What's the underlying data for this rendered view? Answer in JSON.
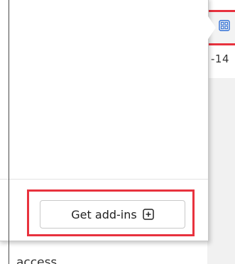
{
  "popup": {
    "get_addins_button": {
      "label": "Get add-ins",
      "icon": "plus-square-icon"
    }
  },
  "background": {
    "cut_number": "-14",
    "cut_text": "access",
    "addins_icon": "addins-grid-icon"
  },
  "colors": {
    "highlight": "#e8323e",
    "button_border": "#c9c9c9",
    "text": "#222222"
  }
}
